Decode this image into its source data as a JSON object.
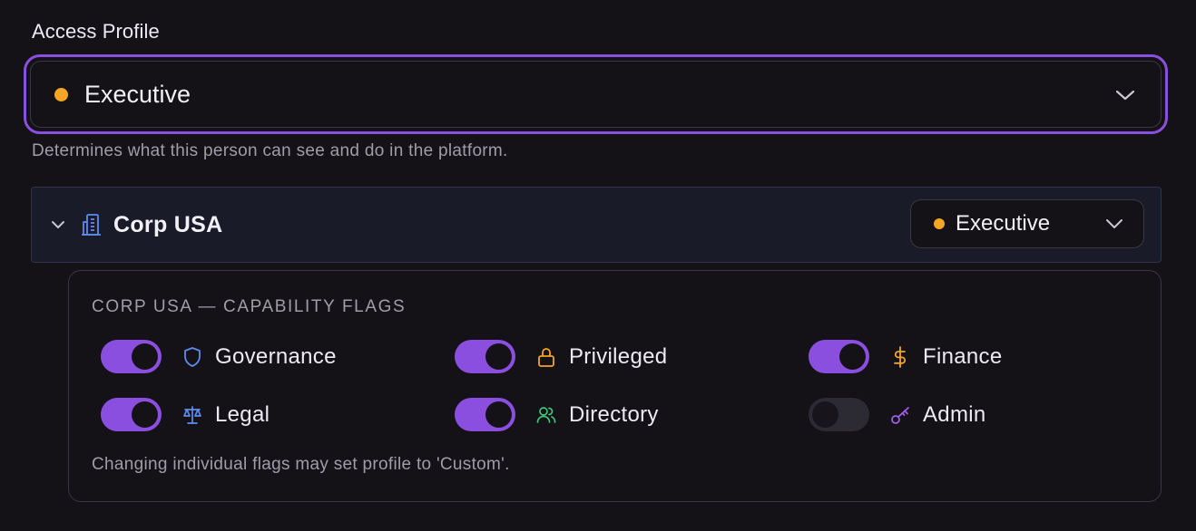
{
  "access_profile": {
    "label": "Access Profile",
    "selected": "Executive",
    "selected_color": "#f5a524",
    "helper": "Determines what this person can see and do in the platform."
  },
  "org": {
    "name": "Corp USA",
    "icon": "building-icon",
    "profile": "Executive",
    "profile_color": "#f5a524",
    "expanded": true
  },
  "flags": {
    "title": "CORP USA — CAPABILITY FLAGS",
    "items": [
      {
        "label": "Governance",
        "icon": "shield-icon",
        "icon_color": "#5b8def",
        "enabled": true
      },
      {
        "label": "Privileged",
        "icon": "lock-icon",
        "icon_color": "#f5a524",
        "enabled": true
      },
      {
        "label": "Finance",
        "icon": "dollar-icon",
        "icon_color": "#f5a524",
        "enabled": true
      },
      {
        "label": "Legal",
        "icon": "scales-icon",
        "icon_color": "#5b8def",
        "enabled": true
      },
      {
        "label": "Directory",
        "icon": "users-icon",
        "icon_color": "#3fc47a",
        "enabled": true
      },
      {
        "label": "Admin",
        "icon": "key-icon",
        "icon_color": "#a25cf0",
        "enabled": false
      }
    ],
    "note": "Changing individual flags may set profile to 'Custom'."
  },
  "colors": {
    "accent": "#8b4fe0",
    "background": "#141217",
    "org_row_bg": "#191b29"
  }
}
